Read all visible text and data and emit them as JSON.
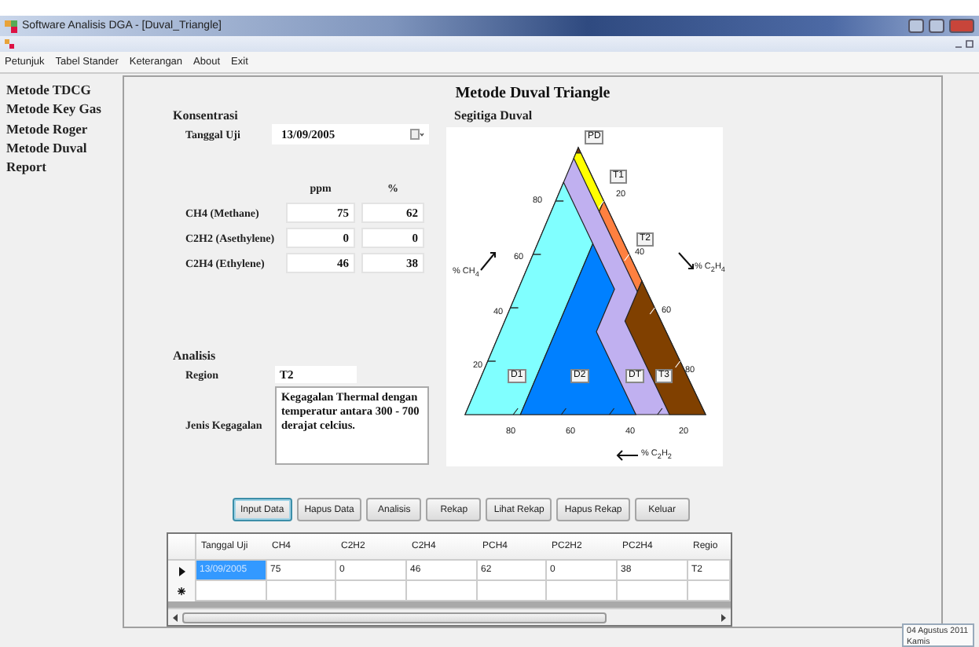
{
  "window": {
    "title": "Software Analisis DGA - [Duval_Triangle]"
  },
  "menu": [
    "Petunjuk",
    "Tabel Stander",
    "Keterangan",
    "About",
    "Exit"
  ],
  "sidebar": {
    "items": [
      "Metode TDCG",
      "Metode Key Gas",
      "Metode Roger",
      "Metode Duval",
      "Report"
    ]
  },
  "form": {
    "title": "Metode Duval Triangle",
    "konsentrasi": {
      "heading": "Konsentrasi",
      "date_label": "Tanggal Uji",
      "date_value": "13/09/2005",
      "columns": [
        "ppm",
        "%"
      ],
      "gases": [
        {
          "name": "CH4 (Methane)",
          "ppm": "75",
          "percent": "62"
        },
        {
          "name": "C2H2 (Asethylene)",
          "ppm": "0",
          "percent": "0"
        },
        {
          "name": "C2H4 (Ethylene)",
          "ppm": "46",
          "percent": "38"
        }
      ]
    },
    "analisis": {
      "heading": "Analisis",
      "region_label": "Region",
      "region_value": "T2",
      "fault_label": "Jenis Kegagalan",
      "fault_value": "Kegagalan Thermal dengan temperatur antara 300 - 700 derajat celcius."
    },
    "triangle": {
      "heading": "Segitiga Duval",
      "zones": [
        {
          "label": "PD",
          "color": "#7a3b10"
        },
        {
          "label": "T1",
          "color": "#ffff00"
        },
        {
          "label": "T2",
          "color": "#ff8040"
        },
        {
          "label": "D1",
          "color": "#80ffff"
        },
        {
          "label": "D2",
          "color": "#0080ff"
        },
        {
          "label": "DT",
          "color": "#c0b0f0"
        },
        {
          "label": "T3",
          "color": "#804000"
        }
      ],
      "axis_labels": [
        "% CH$_{4}$",
        "% C$_{2}$H$_{4}$",
        "% C$_{2}$H$_{2}$"
      ],
      "left_ticks": [
        "80",
        "60",
        "40",
        "20"
      ],
      "right_ticks": [
        "20",
        "40",
        "60",
        "80"
      ],
      "bottom_ticks": [
        "80",
        "60",
        "40",
        "20"
      ]
    }
  },
  "buttons": [
    {
      "label": "Input Data",
      "focused": true
    },
    {
      "label": "Hapus Data",
      "focused": false
    },
    {
      "label": "Analisis",
      "focused": false
    },
    {
      "label": "Rekap",
      "focused": false
    },
    {
      "label": "Lihat Rekap",
      "focused": false
    },
    {
      "label": "Hapus Rekap",
      "focused": false
    },
    {
      "label": "Keluar",
      "focused": false
    }
  ],
  "grid": {
    "columns": [
      "Tanggal Uji",
      "CH4",
      "C2H2",
      "C2H4",
      "PCH4",
      "PC2H2",
      "PC2H4",
      "Regio"
    ],
    "rows": [
      {
        "kind": "current",
        "cells": [
          {
            "text": "13/09/2005",
            "selected": true
          },
          {
            "text": "75",
            "selected": false
          },
          {
            "text": "0",
            "selected": false
          },
          {
            "text": "46",
            "selected": false
          },
          {
            "text": "62",
            "selected": false
          },
          {
            "text": "0",
            "selected": false
          },
          {
            "text": "38",
            "selected": false
          },
          {
            "text": "T2",
            "selected": false
          }
        ]
      },
      {
        "kind": "new",
        "cells": []
      }
    ]
  },
  "status": {
    "date": "04 Agustus 2011",
    "day": "Kamis"
  }
}
